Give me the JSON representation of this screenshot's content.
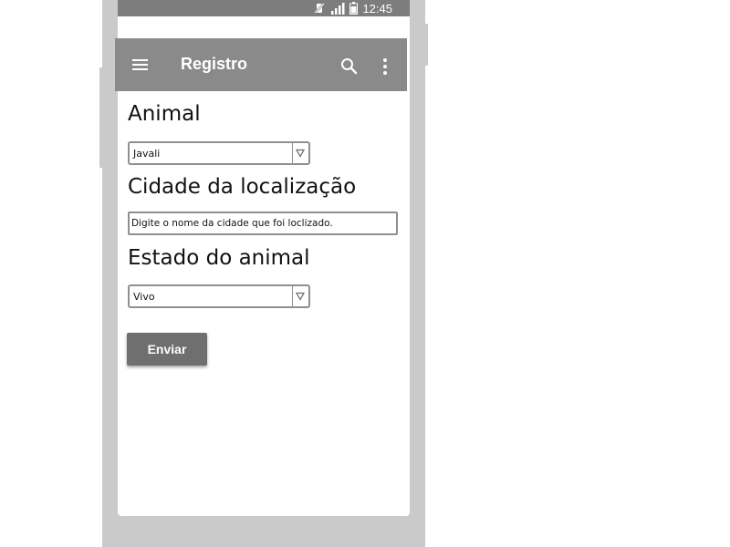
{
  "status_bar": {
    "time": "12:45",
    "icons": [
      "vibrate-off-icon",
      "signal-icon",
      "battery-icon"
    ]
  },
  "app_bar": {
    "title": "Registro",
    "icons": [
      "menu-icon",
      "search-icon",
      "more-vert-icon"
    ]
  },
  "form": {
    "animal": {
      "label": "Animal",
      "selected": "Javali"
    },
    "cidade": {
      "label": "Cidade da localização",
      "placeholder": "Digite o nome da cidade que foi loclizado."
    },
    "estado": {
      "label": "Estado do animal",
      "selected": "Vivo"
    },
    "submit_label": "Enviar"
  },
  "colors": {
    "phone_frame": "#c9cac9",
    "status_bar": "#7d7d7d",
    "app_bar": "#8a8a8a",
    "button": "#6f6f6f"
  }
}
